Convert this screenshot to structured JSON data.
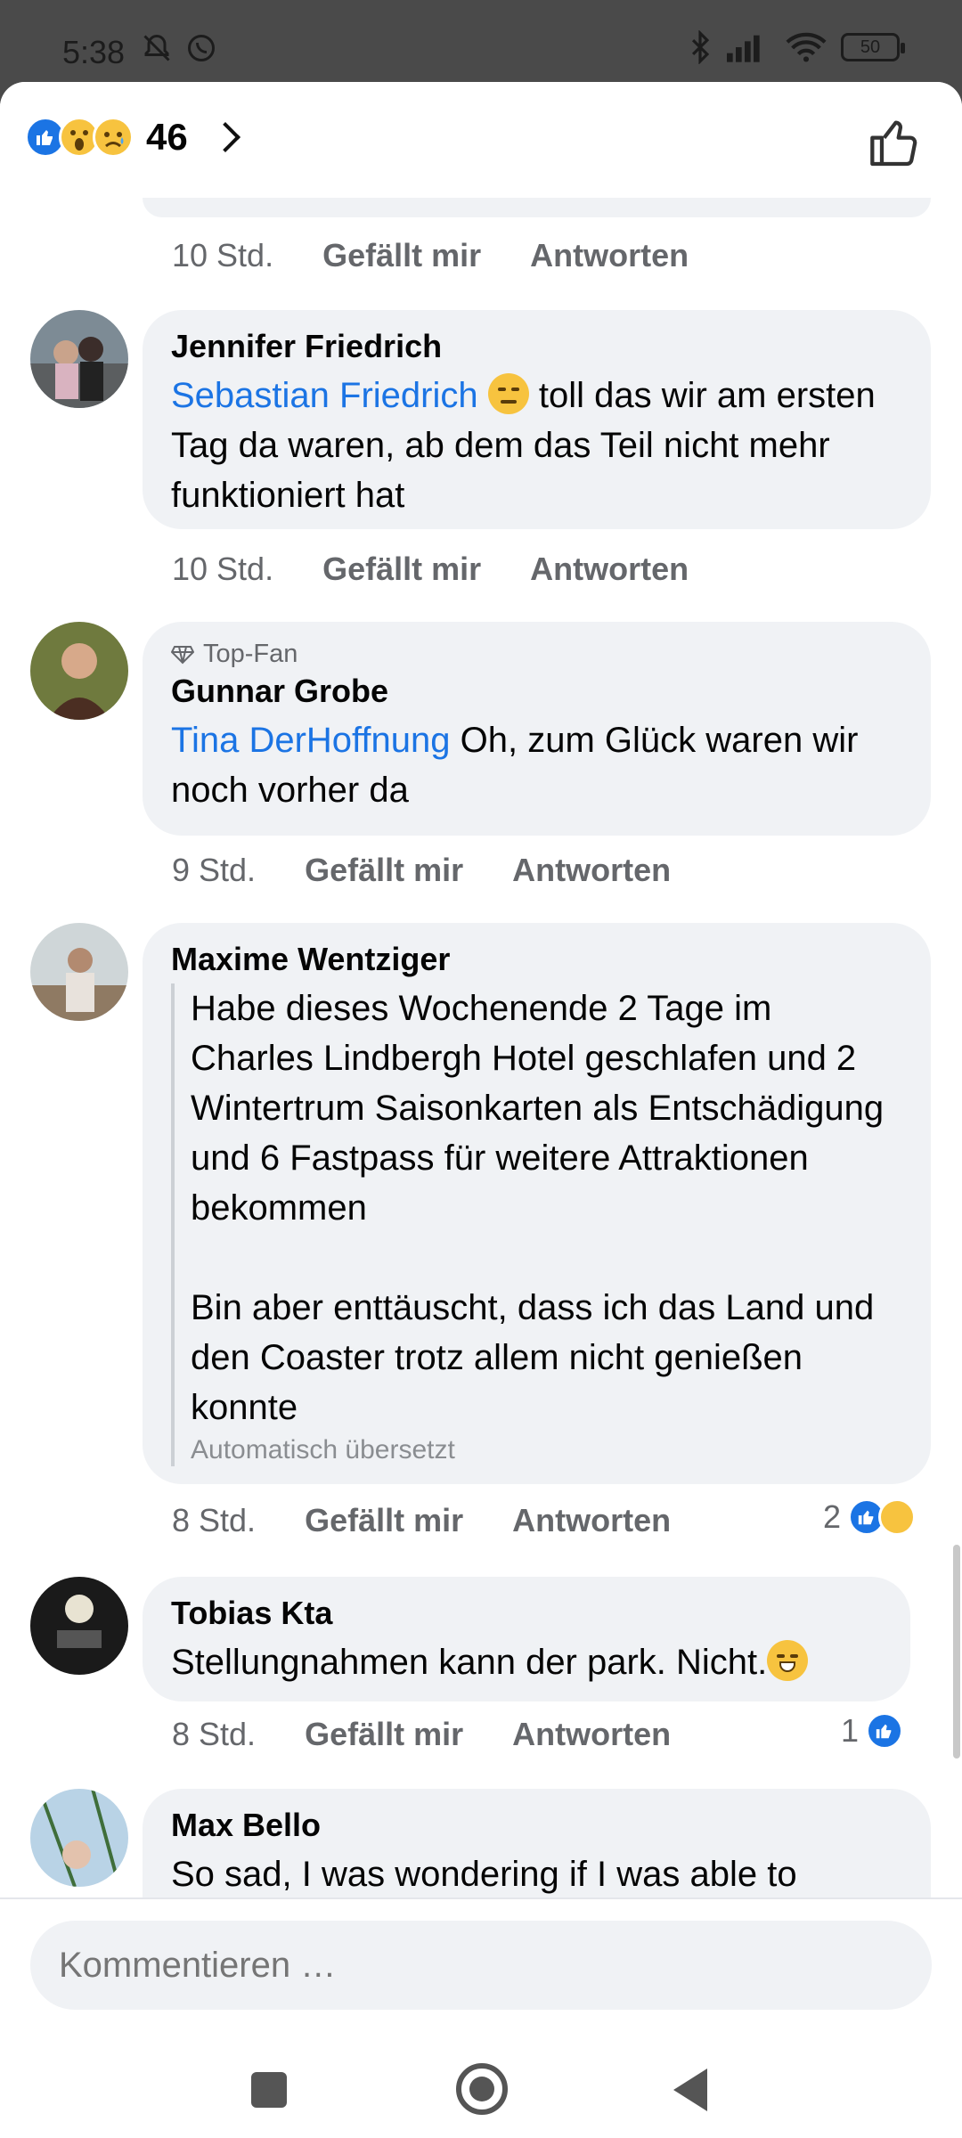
{
  "status_bar": {
    "time": "5:38",
    "battery": "50"
  },
  "header": {
    "reaction_count": "46"
  },
  "comments": [
    {
      "time": "10 Std.",
      "like": "Gefällt mir",
      "reply": "Antworten"
    },
    {
      "author": "Jennifer Friedrich",
      "mention": "Sebastian Friedrich",
      "text": "toll das wir am ersten Tag da waren, ab dem das Teil nicht mehr funktioniert hat",
      "time": "10 Std.",
      "like": "Gefällt mir",
      "reply": "Antworten"
    },
    {
      "badge": "Top-Fan",
      "author": "Gunnar Grobe",
      "mention": "Tina DerHoffnung",
      "text": "Oh, zum Glück waren wir noch vorher da",
      "time": "9 Std.",
      "like": "Gefällt mir",
      "reply": "Antworten"
    },
    {
      "author": "Maxime Wentziger",
      "text_p1": "Habe dieses Wochenende 2 Tage im Charles Lindbergh Hotel geschlafen und 2 Wintertrum Saisonkarten als Entschädigung und 6 Fastpass für weitere Attraktionen bekommen",
      "text_p2": "Bin aber enttäuscht, dass ich das Land und den Coaster trotz allem nicht genießen konnte",
      "auto_translated": "Automatisch übersetzt",
      "time": "8 Std.",
      "like": "Gefällt mir",
      "reply": "Antworten",
      "reactions": "2"
    },
    {
      "author": "Tobias Kta",
      "text": "Stellungnahmen kann der park. Nicht.",
      "time": "8 Std.",
      "like": "Gefällt mir",
      "reply": "Antworten",
      "reactions": "1"
    },
    {
      "author": "Max Bello",
      "text": "So sad, I was wondering if I was able to"
    }
  ],
  "composer": {
    "placeholder": "Kommentieren …"
  },
  "colors": {
    "accent": "#1b74e4",
    "bubble": "#f0f2f5",
    "meta": "#65676b"
  }
}
